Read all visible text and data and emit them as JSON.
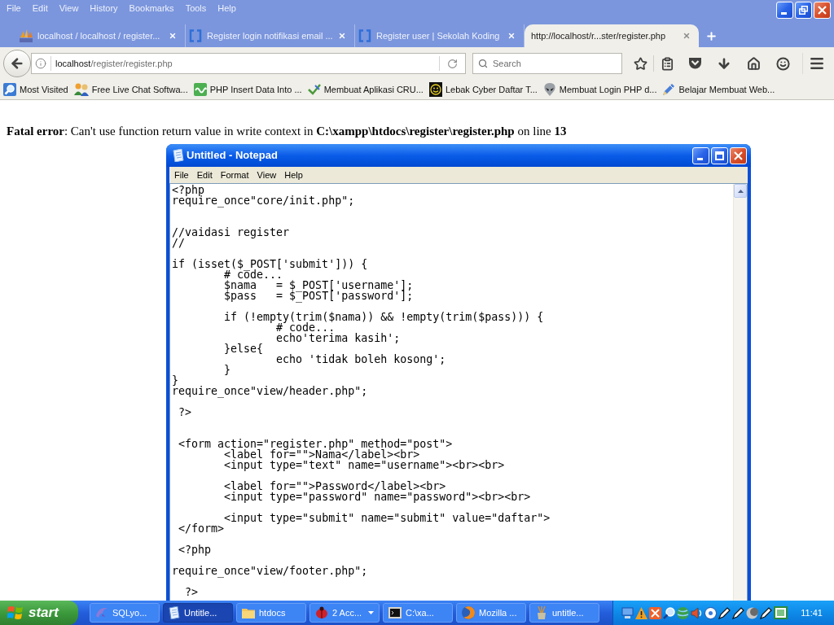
{
  "browser": {
    "menu": [
      "File",
      "Edit",
      "View",
      "History",
      "Bookmarks",
      "Tools",
      "Help"
    ],
    "tabs": [
      {
        "title": "localhost / localhost / register...",
        "kind": "sails",
        "selected": false
      },
      {
        "title": "Register login notifikasi email ...",
        "kind": "brackets",
        "selected": false
      },
      {
        "title": "Register user | Sekolah Koding",
        "kind": "brackets",
        "selected": false
      },
      {
        "title": "http://localhost/r...ster/register.php",
        "kind": "plain",
        "selected": true
      }
    ],
    "address": {
      "host": "localhost",
      "path": "/register/register.php"
    },
    "search": {
      "placeholder": "Search"
    },
    "bookmarks": [
      {
        "label": "Most Visited",
        "kind": "magnifier"
      },
      {
        "label": "Free Live Chat Softwa...",
        "kind": "people"
      },
      {
        "label": "PHP Insert Data Into ...",
        "kind": "tile"
      },
      {
        "label": "Membuat Aplikasi CRU...",
        "kind": "check"
      },
      {
        "label": "Lebak Cyber Daftar T...",
        "kind": "smiley"
      },
      {
        "label": "Membuat Login PHP d...",
        "kind": "alien"
      },
      {
        "label": "Belajar Membuat Web...",
        "kind": "pen"
      }
    ]
  },
  "page": {
    "error": "**Fatal error**: Can't use function return value in write context in **C:\\xampp\\htdocs\\register\\register.php** on line **13**"
  },
  "notepad": {
    "title": "Untitled - Notepad",
    "menu": [
      "File",
      "Edit",
      "Format",
      "View",
      "Help"
    ],
    "text": "<?php\nrequire_once\"core/init.php\";\n\n\n//vaidasi register\n//\n\nif (isset($_POST['submit'])) {\n        # code...\n        $nama   = $_POST['username'];\n        $pass   = $_POST['password'];\n\n        if (!empty(trim($nama)) && !empty(trim($pass))) {\n                # code...\n                echo'terima kasih';\n        }else{\n                echo 'tidak boleh kosong';\n        }\n}\nrequire_once\"view/header.php\";\n\n ?>\n\n\n <form action=\"register.php\" method=\"post\">\n        <label for=\"\">Nama</label><br>\n        <input type=\"text\" name=\"username\"><br><br>\n\n        <label for=\"\">Password</label><br>\n        <input type=\"password\" name=\"password\"><br><br>\n\n        <input type=\"submit\" name=\"submit\" value=\"daftar\">\n </form>\n\n <?php\n\nrequire_once\"view/footer.php\";\n\n  ?>"
  },
  "taskbar": {
    "start": "start",
    "tasks": [
      {
        "label": "SQLyo...",
        "kind": "dolphin",
        "grouped": false,
        "selected": false
      },
      {
        "label": "Untitle...",
        "kind": "notepad",
        "grouped": false,
        "selected": true
      },
      {
        "label": "htdocs",
        "kind": "folder",
        "grouped": false,
        "selected": false
      },
      {
        "label": "2 Acc...",
        "kind": "beetle",
        "grouped": true,
        "selected": false
      },
      {
        "label": "C:\\xa...",
        "kind": "terminal",
        "grouped": false,
        "selected": false
      },
      {
        "label": "Mozilla ...",
        "kind": "globe",
        "grouped": false,
        "selected": false
      },
      {
        "label": "untitle...",
        "kind": "brushes",
        "grouped": false,
        "selected": false
      }
    ],
    "clock": "11:41"
  }
}
